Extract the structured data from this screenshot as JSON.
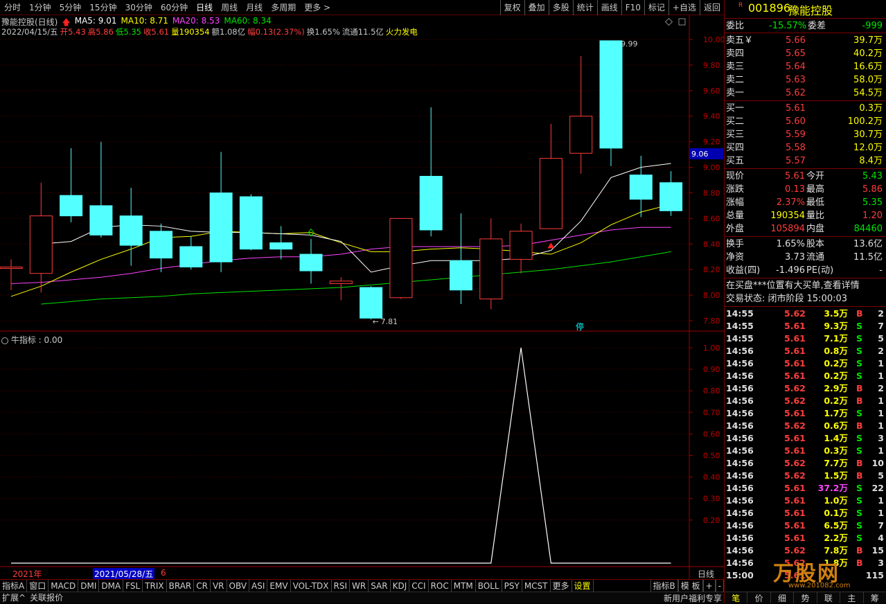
{
  "period_tabs": [
    "分时",
    "1分钟",
    "5分钟",
    "15分钟",
    "30分钟",
    "60分钟",
    "日线",
    "周线",
    "月线",
    "多周期",
    "更多 >"
  ],
  "active_tab": "日线",
  "toolbar_right": [
    "复权",
    "叠加",
    "多股",
    "统计",
    "画线",
    "F10",
    "标记",
    "+自选",
    "返回"
  ],
  "chart_title": "豫能控股(日线)",
  "ma": {
    "ma5": "MA5: 9.01",
    "ma10": "MA10: 8.71",
    "ma20": "MA20: 8.53",
    "ma60": "MA60: 8.34"
  },
  "bar_info": {
    "date": "2022/04/15/五",
    "open": "开5.43",
    "high": "高5.86",
    "low": "低5.35",
    "close": "收5.61",
    "vol": "量190354",
    "amt": "额1.08亿",
    "chg": "幅0.13(2.37%)",
    "turn": "换1.65%",
    "float": "流通11.5亿",
    "tag": "火力发电"
  },
  "price_axis": [
    "10.00",
    "9.80",
    "9.60",
    "9.40",
    "9.20",
    "9.00",
    "8.80",
    "8.60",
    "8.40",
    "8.20",
    "8.00",
    "7.80"
  ],
  "current_price_tag": "9.06",
  "high_label": "9.99",
  "low_label": "7.81",
  "stop_label": "停",
  "indicator_title": "牛指标 : 0.00",
  "indicator_axis": [
    "1.00",
    "0.90",
    "0.80",
    "0.70",
    "0.60",
    "0.50",
    "0.40",
    "0.30",
    "0.20"
  ],
  "date_axis": {
    "year": "2021年",
    "date": "2021/05/28/五",
    "month": "6",
    "right": "日线"
  },
  "indicator_tabs": [
    "指标A",
    "窗口",
    "MACD",
    "DMI",
    "DMA",
    "FSL",
    "TRIX",
    "BRAR",
    "CR",
    "VR",
    "OBV",
    "ASI",
    "EMV",
    "VOL-TDX",
    "RSI",
    "WR",
    "SAR",
    "KDJ",
    "CCI",
    "ROC",
    "MTM",
    "BOLL",
    "PSY",
    "MCST",
    "更多",
    "设置"
  ],
  "indicator_tabs_right": [
    "指标B",
    "模 板",
    "+",
    "-"
  ],
  "status_left": [
    "扩展^",
    "关联报价"
  ],
  "status_right": [
    "新用户福利专享"
  ],
  "stock": {
    "code": "001896",
    "name": "豫能控股",
    "weibi_label": "委比",
    "weibi": "-15.57%",
    "weicha_label": "委差",
    "weicha": "-999"
  },
  "asks": [
    {
      "label": "卖五￥",
      "price": "5.66",
      "vol": "39.7万"
    },
    {
      "label": "卖四",
      "price": "5.65",
      "vol": "40.2万"
    },
    {
      "label": "卖三",
      "price": "5.64",
      "vol": "16.6万"
    },
    {
      "label": "卖二",
      "price": "5.63",
      "vol": "58.0万"
    },
    {
      "label": "卖一",
      "price": "5.62",
      "vol": "54.5万"
    }
  ],
  "bids": [
    {
      "label": "买一",
      "price": "5.61",
      "vol": "0.3万"
    },
    {
      "label": "买二",
      "price": "5.60",
      "vol": "100.2万"
    },
    {
      "label": "买三",
      "price": "5.59",
      "vol": "30.7万"
    },
    {
      "label": "买四",
      "price": "5.58",
      "vol": "12.0万"
    },
    {
      "label": "买五",
      "price": "5.57",
      "vol": "8.4万"
    }
  ],
  "stats": [
    {
      "l1": "现价",
      "v1": "5.61",
      "l2": "今开",
      "v2": "5.43"
    },
    {
      "l1": "涨跌",
      "v1": "0.13",
      "l2": "最高",
      "v2": "5.86"
    },
    {
      "l1": "涨幅",
      "v1": "2.37%",
      "l2": "最低",
      "v2": "5.35"
    },
    {
      "l1": "总量",
      "v1": "190354",
      "l2": "量比",
      "v2": "1.20"
    },
    {
      "l1": "外盘",
      "v1": "105894",
      "l2": "内盘",
      "v2": "84460"
    }
  ],
  "stats2": [
    {
      "l1": "换手",
      "v1": "1.65%",
      "l2": "股本",
      "v2": "13.6亿"
    },
    {
      "l1": "净资",
      "v1": "3.73",
      "l2": "流通",
      "v2": "11.5亿"
    },
    {
      "l1": "收益(四)",
      "v1": "-1.496",
      "l2": "PE(动)",
      "v2": "-"
    }
  ],
  "notice": "在买盘***位置有大买单,查看详情",
  "trade_status": "交易状态: 闭市阶段 15:00:03",
  "ticks": [
    [
      "14:55",
      "5.62",
      "3.5万",
      "B",
      "2"
    ],
    [
      "14:55",
      "5.61",
      "9.3万",
      "S",
      "7"
    ],
    [
      "14:55",
      "5.61",
      "7.1万",
      "S",
      "5"
    ],
    [
      "14:56",
      "5.61",
      "0.8万",
      "S",
      "2"
    ],
    [
      "14:56",
      "5.61",
      "0.2万",
      "S",
      "1"
    ],
    [
      "14:56",
      "5.61",
      "0.2万",
      "S",
      "1"
    ],
    [
      "14:56",
      "5.62",
      "2.9万",
      "B",
      "2"
    ],
    [
      "14:56",
      "5.62",
      "0.2万",
      "B",
      "1"
    ],
    [
      "14:56",
      "5.61",
      "1.7万",
      "S",
      "1"
    ],
    [
      "14:56",
      "5.62",
      "0.6万",
      "B",
      "1"
    ],
    [
      "14:56",
      "5.61",
      "1.4万",
      "S",
      "3"
    ],
    [
      "14:56",
      "5.61",
      "0.3万",
      "S",
      "1"
    ],
    [
      "14:56",
      "5.62",
      "7.7万",
      "B",
      "10"
    ],
    [
      "14:56",
      "5.62",
      "1.5万",
      "B",
      "5"
    ],
    [
      "14:56",
      "5.61",
      "37.2万",
      "S",
      "22"
    ],
    [
      "14:56",
      "5.61",
      "1.0万",
      "S",
      "1"
    ],
    [
      "14:56",
      "5.61",
      "0.1万",
      "S",
      "1"
    ],
    [
      "14:56",
      "5.61",
      "6.5万",
      "S",
      "7"
    ],
    [
      "14:56",
      "5.61",
      "2.2万",
      "S",
      "4"
    ],
    [
      "14:56",
      "5.62",
      "7.8万",
      "B",
      "15"
    ],
    [
      "14:56",
      "5.62",
      "1.8万",
      "B",
      "3"
    ],
    [
      "15:00",
      "5.61",
      "",
      "",
      "115"
    ]
  ],
  "right_tabs": [
    "笔",
    "价",
    "细",
    "势",
    "联",
    "主",
    "筹"
  ],
  "watermark": "万股网",
  "watermark_url": "www.201082.com",
  "candles": [
    {
      "o": 8.22,
      "c": 8.22,
      "h": 8.28,
      "l": 8.04
    },
    {
      "o": 8.17,
      "c": 8.62,
      "h": 8.88,
      "l": 8.02
    },
    {
      "o": 8.78,
      "c": 8.62,
      "h": 9.15,
      "l": 8.57
    },
    {
      "o": 8.7,
      "c": 8.47,
      "h": 9.2,
      "l": 8.45
    },
    {
      "o": 8.62,
      "c": 8.39,
      "h": 8.84,
      "l": 8.23
    },
    {
      "o": 8.5,
      "c": 8.29,
      "h": 8.56,
      "l": 8.18
    },
    {
      "o": 8.38,
      "c": 8.22,
      "h": 8.46,
      "l": 8.2
    },
    {
      "o": 8.8,
      "c": 8.26,
      "h": 9.12,
      "l": 8.18
    },
    {
      "o": 8.77,
      "c": 8.36,
      "h": 8.79,
      "l": 8.35
    },
    {
      "o": 8.41,
      "c": 8.36,
      "h": 8.54,
      "l": 8.28
    },
    {
      "o": 8.32,
      "c": 8.19,
      "h": 8.44,
      "l": 8.09
    },
    {
      "o": 8.09,
      "c": 8.11,
      "h": 8.14,
      "l": 7.96
    },
    {
      "o": 8.06,
      "c": 7.82,
      "h": 8.07,
      "l": 7.81
    },
    {
      "o": 7.98,
      "c": 8.6,
      "h": 8.6,
      "l": 7.97
    },
    {
      "o": 8.93,
      "c": 8.51,
      "h": 9.47,
      "l": 8.46
    },
    {
      "o": 8.27,
      "c": 8.04,
      "h": 8.64,
      "l": 7.93
    },
    {
      "o": 7.97,
      "c": 8.44,
      "h": 8.6,
      "l": 7.89
    },
    {
      "o": 8.28,
      "c": 8.5,
      "h": 8.56,
      "l": 8.17
    },
    {
      "o": 8.52,
      "c": 9.07,
      "h": 9.34,
      "l": 8.52
    },
    {
      "o": 9.11,
      "c": 9.4,
      "h": 9.87,
      "l": 8.95
    },
    {
      "o": 9.99,
      "c": 9.15,
      "h": 9.99,
      "l": 9.01
    },
    {
      "o": 8.94,
      "c": 8.75,
      "h": 9.09,
      "l": 8.61
    },
    {
      "o": 8.88,
      "c": 8.66,
      "h": 8.97,
      "l": 8.62
    }
  ],
  "ma5_values": [
    null,
    8.4,
    8.42,
    8.53,
    8.55,
    8.54,
    8.5,
    8.49,
    8.49,
    8.48,
    8.47,
    8.42,
    8.18,
    8.23,
    8.27,
    8.27,
    8.27,
    8.29,
    8.35,
    8.58,
    8.92,
    9.0,
    9.03
  ],
  "ma10_values": [
    7.99,
    8.07,
    8.18,
    8.28,
    8.36,
    8.45,
    8.46,
    8.5,
    8.49,
    8.48,
    8.49,
    8.41,
    8.34,
    8.34,
    8.36,
    8.37,
    8.36,
    8.34,
    8.32,
    8.41,
    8.55,
    8.65,
    8.71
  ],
  "ma20_values": [
    8.09,
    8.1,
    8.12,
    8.14,
    8.17,
    8.21,
    8.24,
    8.27,
    8.29,
    8.3,
    8.3,
    8.32,
    8.36,
    8.38,
    8.38,
    8.38,
    8.38,
    8.39,
    8.43,
    8.47,
    8.51,
    8.53,
    8.53
  ],
  "ma60_values": [
    null,
    7.93,
    7.95,
    7.97,
    7.98,
    7.99,
    8.01,
    8.02,
    8.03,
    8.04,
    8.05,
    8.06,
    8.08,
    8.1,
    8.12,
    8.14,
    8.16,
    8.18,
    8.2,
    8.23,
    8.26,
    8.3,
    8.34
  ],
  "indicator_values": [
    0,
    0,
    0,
    0,
    0,
    0,
    0,
    0,
    0,
    0,
    0,
    0,
    0,
    0,
    0,
    0,
    0,
    1,
    0,
    0,
    0,
    0,
    0
  ]
}
